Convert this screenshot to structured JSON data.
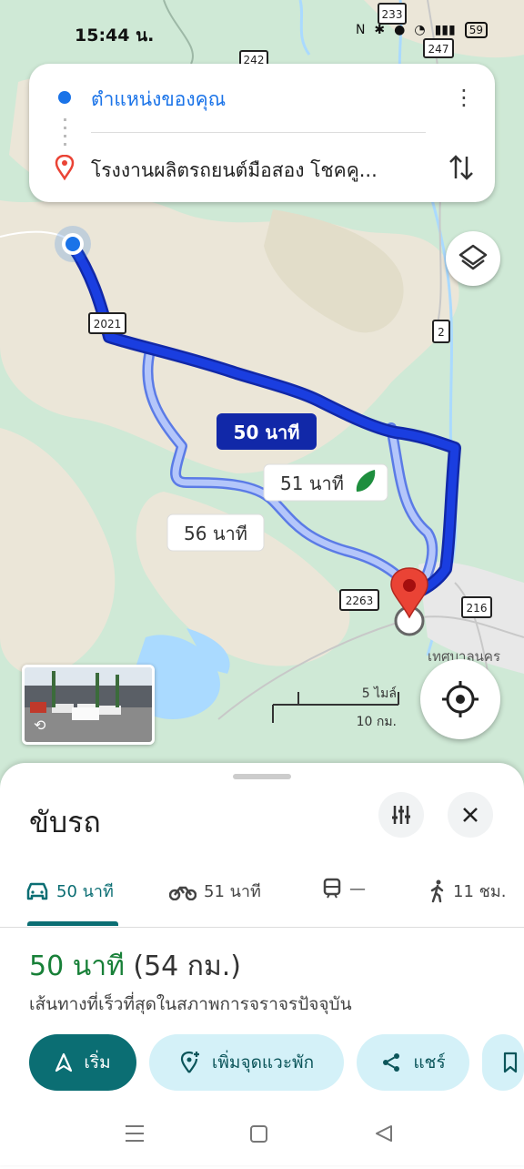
{
  "status_bar": {
    "time": "15:44 น.",
    "battery": "59"
  },
  "directions_card": {
    "origin": "ตำแหน่งของคุณ",
    "destination": "โรงงานผลิตรถยนต์มือสอง โชคคู..."
  },
  "map": {
    "route_labels": {
      "primary": "50 นาที",
      "alt1": "51 นาที",
      "alt2": "56 นาที"
    },
    "road_shields": [
      "233",
      "247",
      "242",
      "2021",
      "2",
      "2263",
      "216"
    ],
    "place_label": "เทศบาลนคร",
    "scale": {
      "miles": "5 ไมล์",
      "km": "10 กม."
    }
  },
  "sheet": {
    "title": "ขับรถ",
    "tabs": [
      {
        "mode": "car",
        "label": "50 นาที"
      },
      {
        "mode": "motorcycle",
        "label": "51 นาที"
      },
      {
        "mode": "transit",
        "label": "—"
      },
      {
        "mode": "walk",
        "label": "11 ชม."
      }
    ],
    "summary_time": "50 นาที",
    "summary_distance": "(54 กม.)",
    "route_description": "เส้นทางที่เร็วที่สุดในสภาพการจราจรปัจจุบัน",
    "actions": {
      "start": "เริ่ม",
      "add_stop": "เพิ่มจุดแวะพัก",
      "share": "แชร์"
    }
  },
  "colors": {
    "route_primary": "#1a3ee0",
    "route_alt": "#8fa8f5",
    "accent": "#0b6e73",
    "map_green": "#cfe9d6",
    "map_tan": "#ebe6d8",
    "water": "#aadaff"
  }
}
